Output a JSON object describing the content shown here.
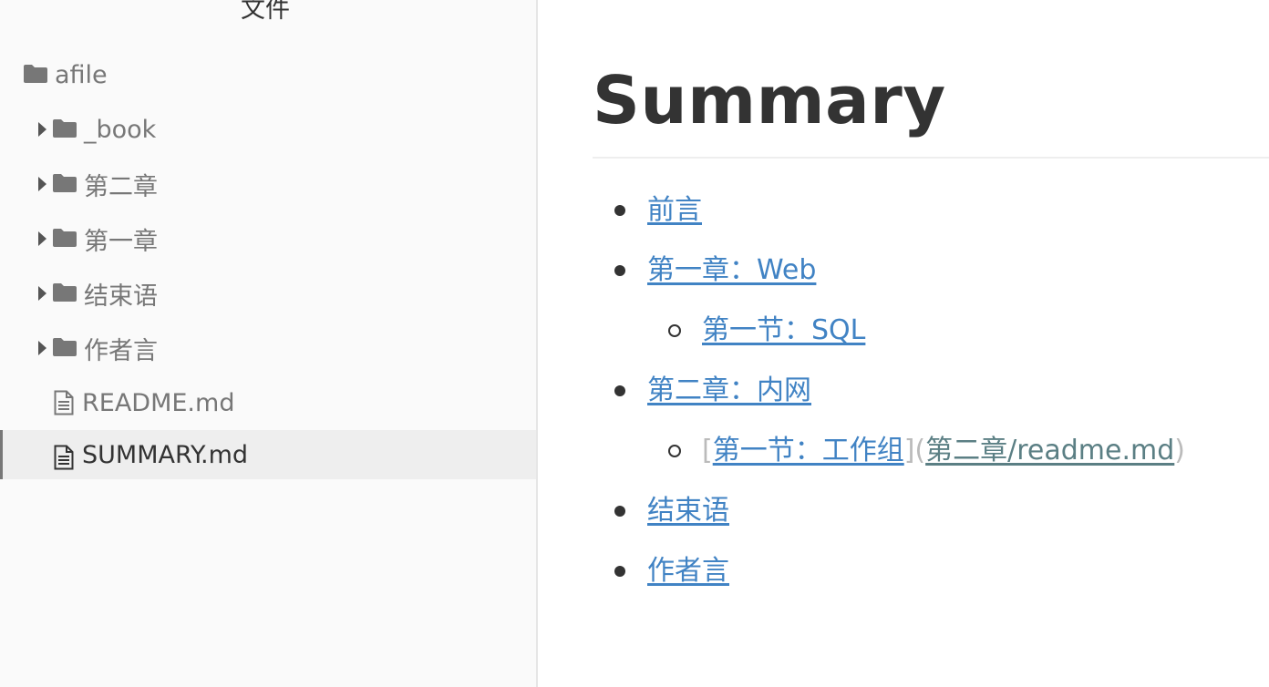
{
  "sidebar": {
    "title": "文件",
    "root": {
      "label": "afile",
      "icon": "folder-icon"
    },
    "items": [
      {
        "label": "_book",
        "type": "folder",
        "icon": "folder-icon"
      },
      {
        "label": "第二章",
        "type": "folder",
        "icon": "folder-icon"
      },
      {
        "label": "第一章",
        "type": "folder",
        "icon": "folder-icon"
      },
      {
        "label": "结束语",
        "type": "folder",
        "icon": "folder-icon"
      },
      {
        "label": "作者言",
        "type": "folder",
        "icon": "folder-icon"
      },
      {
        "label": "README.md",
        "type": "file",
        "icon": "file-icon"
      },
      {
        "label": "SUMMARY.md",
        "type": "file",
        "icon": "file-icon",
        "active": true
      }
    ]
  },
  "document": {
    "title": "Summary",
    "toc": [
      {
        "label": "前言"
      },
      {
        "label": "第一章：Web"
      },
      {
        "label": "第一节：SQL"
      },
      {
        "label": "第二章：内网"
      },
      {
        "open_bracket": "[",
        "label": "第一节：工作组",
        "mid": "](",
        "url": "第二章/readme.md",
        "close": ")"
      },
      {
        "label": "结束语"
      },
      {
        "label": "作者言"
      }
    ]
  },
  "colors": {
    "link": "#4183c4",
    "raw_url": "#5b7f84",
    "sidebar_bg": "#fafafa",
    "active_row_bg": "#eeeeee",
    "heading": "#333333"
  }
}
